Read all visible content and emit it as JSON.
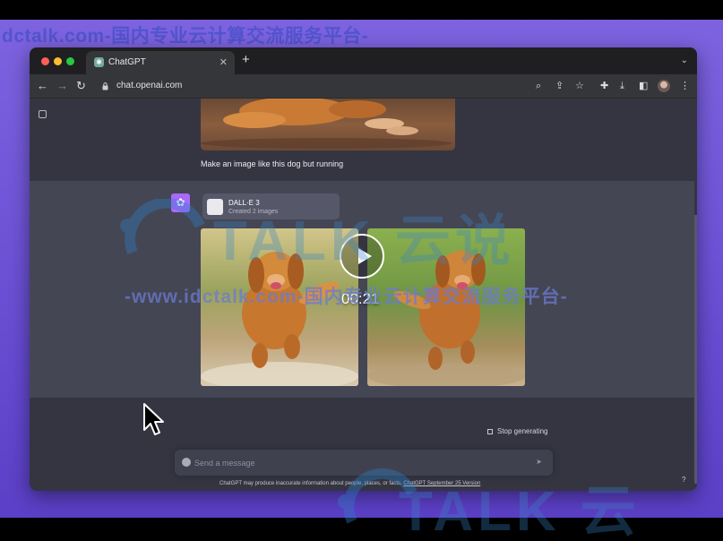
{
  "watermarks": {
    "top": "dctalk.com-国内专业云计算交流服务平台-",
    "center_brand": "TALK 云说",
    "center_text": "-www.idctalk.com-国内专业云计算交流服务平台-",
    "bottom_brand": "TALK 云"
  },
  "browser": {
    "tab_title": "ChatGPT",
    "url": "chat.openai.com",
    "icons": [
      "back-arrow-icon",
      "forward-arrow-icon",
      "reload-icon",
      "lock-icon",
      "zoom-icon",
      "share-icon",
      "star-icon",
      "extensions-icon",
      "download-icon",
      "sidepanel-icon",
      "profile-avatar",
      "more-menu-icon"
    ]
  },
  "chat": {
    "user_message": "Make an image like this dog but running",
    "assistant": {
      "tool_name": "DALL·E 3",
      "tool_status": "Created 2 images"
    },
    "stop_label": "Stop generating",
    "composer_placeholder": "Send a message",
    "disclaimer_text": "ChatGPT may produce inaccurate information about people, places, or facts.",
    "disclaimer_link": "ChatGPT September 25 Version",
    "help": "?"
  },
  "video": {
    "timestamp": "00:21"
  },
  "colors": {
    "chat_bg": "#343541",
    "assistant_bg": "#444654",
    "desktop": "#6a4fd4",
    "gpt_avatar": "#ab68ff"
  }
}
